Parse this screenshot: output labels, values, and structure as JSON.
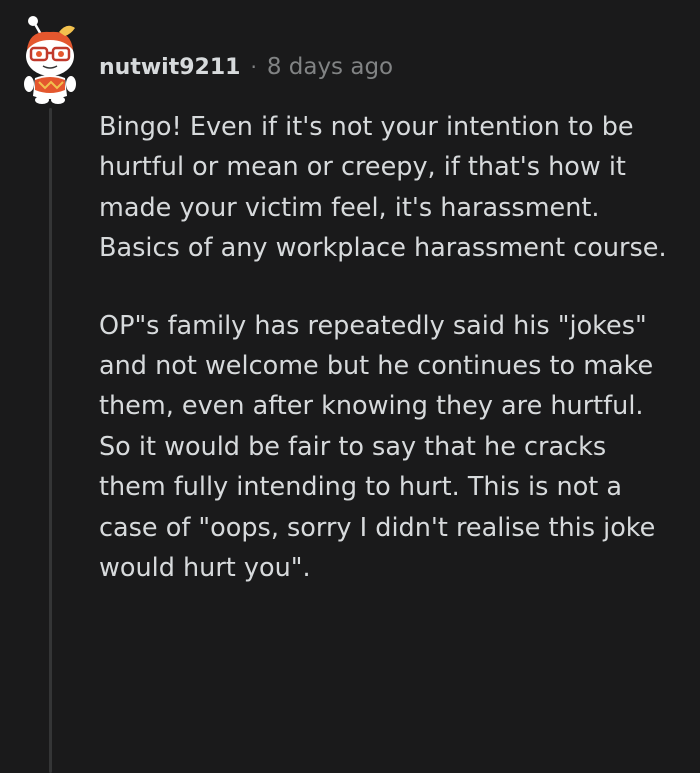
{
  "comment": {
    "author": "nutwit9211",
    "separator": "·",
    "timestamp": "8 days ago",
    "avatar_icon": "snoo-avatar-icon",
    "paragraphs": [
      "Bingo! Even if it's not your intention to be hurtful or mean or creepy, if that's how it made your victim feel, it's harassment. Basics of any workplace harassment course.",
      "OP\"s family has repeatedly said his \"jokes\" and not welcome but he continues to make them, even after knowing they are hurtful. So it would be fair to say that he cracks them fully intending to hurt. This is not a case of \"oops, sorry I didn't realise this joke would hurt you\"."
    ]
  },
  "colors": {
    "background": "#1a1a1b",
    "text": "#d7dadc",
    "meta": "#818384",
    "thread_line": "#343536",
    "avatar_hair": "#e4572e",
    "avatar_shirt": "#e4572e"
  }
}
